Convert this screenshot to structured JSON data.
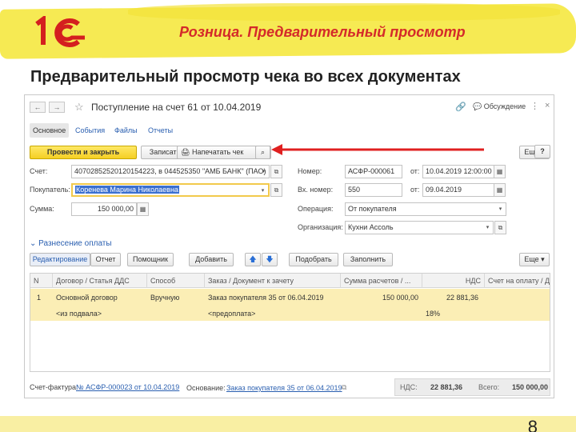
{
  "slide": {
    "title": "Розница. Предварительный просмотр",
    "subtitle": "Предварительный просмотр чека во всех документах",
    "page_number": "8",
    "logo_text": "1С"
  },
  "window": {
    "title": "Поступление на счет 61 от 10.04.2019",
    "discuss_label": "Обсуждение",
    "nav_back": "←",
    "nav_forward": "→",
    "more": "⋮",
    "close": "×"
  },
  "tabs": [
    "Основное",
    "События",
    "Файлы",
    "Отчеты"
  ],
  "toolbar": {
    "post_close": "Провести и закрыть",
    "save": "Записать",
    "print_receipt": "Напечатать чек",
    "more": "Еще",
    "help": "?"
  },
  "form": {
    "account_label": "Счет:",
    "account_value": "40702852520120154223, в 044525350 \"АМБ БАНК\" (ПАО)",
    "buyer_label": "Покупатель:",
    "buyer_value": "Коренева Марина Николаевна",
    "sum_label": "Сумма:",
    "sum_value": "150 000,00",
    "number_label": "Номер:",
    "number_value": "АСФР-000061",
    "from_label": "от:",
    "date_value": "10.04.2019 12:00:00",
    "in_number_label": "Вх. номер:",
    "in_number_value": "550",
    "in_date_value": "09.04.2019",
    "operation_label": "Операция:",
    "operation_value": "От покупателя",
    "organization_label": "Организация:",
    "organization_value": "Кухни Ассоль"
  },
  "payment_section": {
    "title": "Разнесение оплаты",
    "buttons": {
      "edit": "Редактирование",
      "report": "Отчет",
      "assistant": "Помощник",
      "add": "Добавить",
      "pick": "Подобрать",
      "fill": "Заполнить",
      "more": "Еще"
    }
  },
  "table": {
    "headers": [
      "N",
      "Договор / Статья ДДС",
      "Способ",
      "Заказ / Документ к зачету",
      "Сумма расчетов / ...",
      "НДС",
      "Счет на оплату / Д"
    ],
    "row": {
      "n": "1",
      "contract": "Основной договор",
      "cash_item": "<из подвала>",
      "method": "Вручную",
      "order": "Заказ покупателя 35 от 06.04.2019",
      "prepay": "<предоплата>",
      "sum": "150 000,00",
      "vat": "22 881,36",
      "vat_rate": "18%"
    }
  },
  "footer": {
    "invoice_label": "Счет-фактура:",
    "invoice_link": "№ АСФР-000023  от 10.04.2019",
    "basis_label": "Основание:",
    "basis_link": "Заказ покупателя 35 от 06.04.2019",
    "vat_label": "НДС:",
    "vat_value": "22 881,36",
    "total_label": "Всего:",
    "total_value": "150 000,00"
  }
}
